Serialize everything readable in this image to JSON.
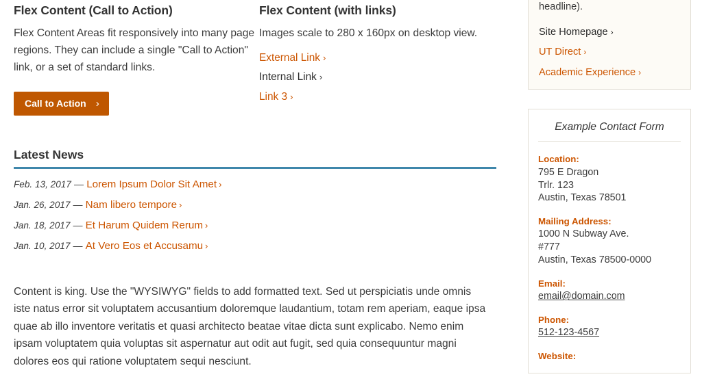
{
  "colors": {
    "accent_orange": "#bf5700",
    "link_orange": "#cc5500",
    "rule_blue": "#3f87ab",
    "box_border": "#e2ded5",
    "box_cream_bg": "#fdfbf6",
    "text_dark": "#3b3b3b"
  },
  "flex_cta": {
    "title": "Flex Content (Call to Action)",
    "body": "Flex Content Areas fit responsively into many page regions. They can include a single \"Call to Action\" link, or a set of standard links.",
    "button_label": "Call to Action",
    "button_chevron": "›"
  },
  "flex_links": {
    "title": "Flex Content (with links)",
    "body": "Images scale to 280 x 160px on desktop view.",
    "chevron": "›",
    "items": [
      {
        "label": "External Link",
        "style": "orange"
      },
      {
        "label": "Internal Link",
        "style": "dark"
      },
      {
        "label": "Link 3",
        "style": "orange"
      }
    ]
  },
  "latest_news": {
    "heading": "Latest News",
    "dash": "—",
    "chevron": "›",
    "items": [
      {
        "date": "Feb. 13, 2017",
        "title": "Lorem Ipsum Dolor Sit Amet"
      },
      {
        "date": "Jan. 26, 2017",
        "title": "Nam libero tempore"
      },
      {
        "date": "Jan. 18, 2017",
        "title": "Et Harum Quidem Rerum"
      },
      {
        "date": "Jan. 10, 2017",
        "title": "At Vero Eos et Accusamu"
      }
    ]
  },
  "content_paragraph": {
    "text": "Content is king. Use the \"WYSIWYG\" fields to add formatted text. Sed ut perspiciatis unde omnis iste natus error sit voluptatem accusantium doloremque laudantium, totam rem aperiam, eaque ipsa quae ab illo inventore veritatis et quasi architecto beatae vitae dicta sunt explicabo. Nemo enim ipsam voluptatem quia voluptas sit aspernatur aut odit aut fugit, sed quia consequuntur magni dolores eos qui ratione voluptatem sequi nesciunt."
  },
  "sidebar": {
    "links_box": {
      "partial_text": "headline).",
      "chevron": "›",
      "items": [
        {
          "label": "Site Homepage",
          "style": "dark"
        },
        {
          "label": "UT Direct",
          "style": "orange"
        },
        {
          "label": "Academic Experience",
          "style": "orange"
        }
      ]
    },
    "contact_box": {
      "title": "Example Contact Form",
      "groups": [
        {
          "label": "Location:",
          "lines": [
            "795 E Dragon",
            "Trlr. 123",
            "Austin, Texas 78501"
          ],
          "link": false
        },
        {
          "label": "Mailing Address:",
          "lines": [
            "1000 N Subway Ave.",
            "#777",
            "Austin, Texas 78500-0000"
          ],
          "link": false
        },
        {
          "label": "Email:",
          "lines": [
            "email@domain.com"
          ],
          "link": true
        },
        {
          "label": "Phone:",
          "lines": [
            "512-123-4567"
          ],
          "link": true
        },
        {
          "label": "Website:",
          "lines": [],
          "link": true
        }
      ]
    }
  }
}
